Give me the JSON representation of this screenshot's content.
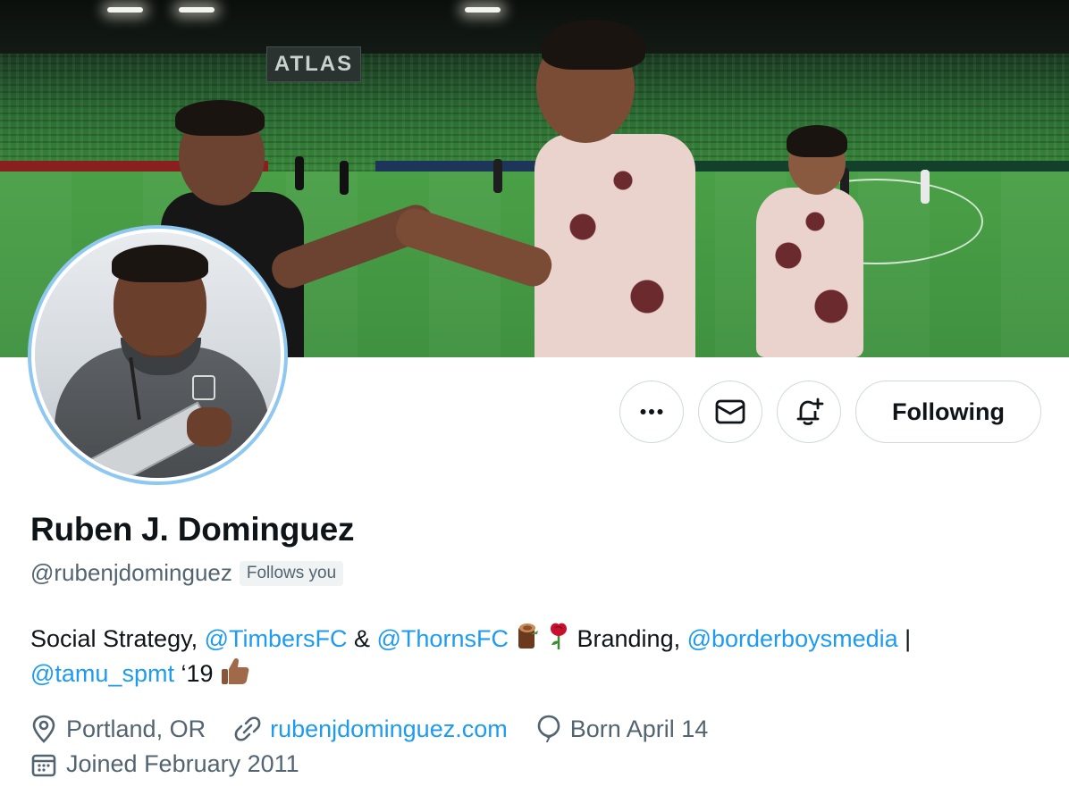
{
  "profile": {
    "name": "Ruben J. Dominguez",
    "handle": "@rubenjdominguez",
    "follows_you": "Follows you",
    "bio": {
      "text1": "Social Strategy, ",
      "mention1": "@TimbersFC",
      "text2": " & ",
      "mention2": "@ThornsFC",
      "text3": " Branding, ",
      "mention3": "@borderboysmedia",
      "text4": " |",
      "mention4": "@tamu_spmt",
      "text5": " ‘19 "
    },
    "location": "Portland, OR",
    "website": "rubenjdominguez.com",
    "birthday": "Born April 14",
    "joined": "Joined February 2011"
  },
  "banner": {
    "stadium_sign": "ATLAS"
  },
  "actions": {
    "more_icon": "more-icon",
    "message_icon": "envelope-icon",
    "notify_icon": "bell-plus-icon",
    "follow_label": "Following"
  },
  "colors": {
    "accent": "#1d9bf0",
    "secondary_text": "#536471",
    "avatar_ring": "#8ec8f0"
  }
}
